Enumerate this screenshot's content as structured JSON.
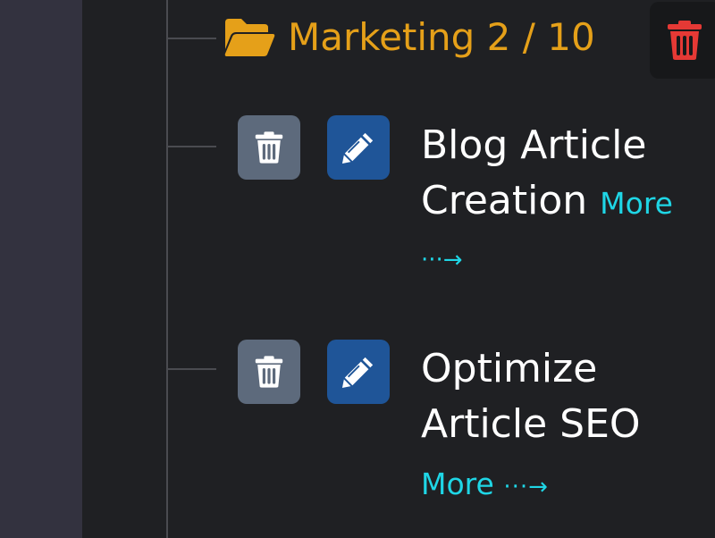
{
  "folder": {
    "name": "Marketing 2 / 10",
    "icon": "folder-open-icon",
    "color": "#e5a019",
    "delete_icon": "trash-icon",
    "delete_color": "#e53935"
  },
  "tasks": [
    {
      "title": "Blog Article Creation",
      "more_label": "More",
      "more_arrow": "···→",
      "delete_icon": "trash-icon",
      "edit_icon": "pencil-icon"
    },
    {
      "title": "Optimize Article SEO",
      "more_label": "More",
      "more_arrow": "···→",
      "delete_icon": "trash-icon",
      "edit_icon": "pencil-icon"
    }
  ],
  "colors": {
    "background": "#1f2023",
    "sidebar": "#33323f",
    "link": "#1fd6e6",
    "delete_button": "#5d6a7c",
    "edit_button": "#1f5598"
  }
}
